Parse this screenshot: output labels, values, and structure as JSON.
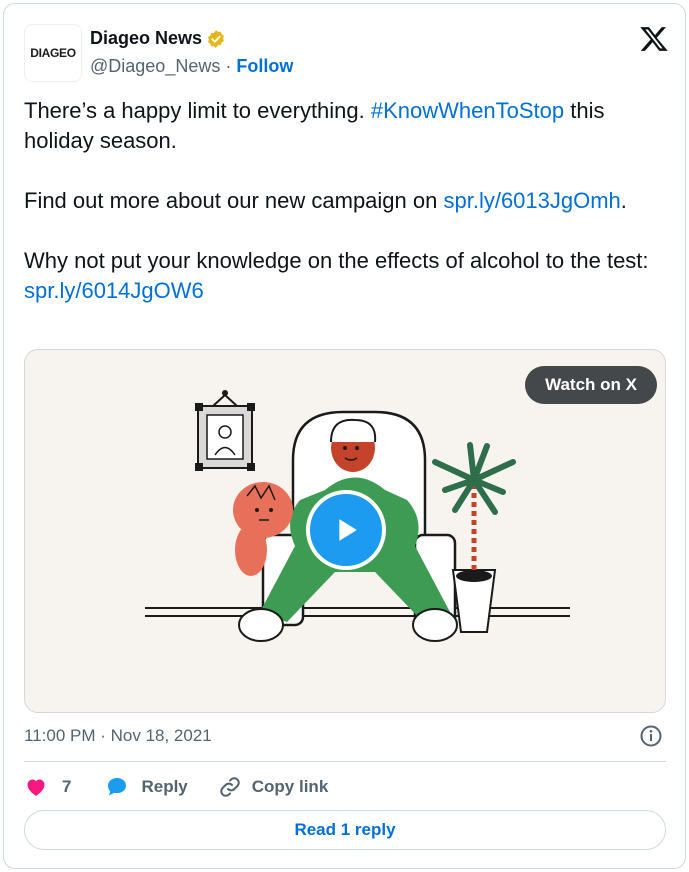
{
  "author": {
    "avatar_text": "DIAGEO",
    "display_name": "Diageo News",
    "handle": "@Diageo_News",
    "separator": "·",
    "follow_label": "Follow"
  },
  "tweet": {
    "line1_before": "There’s a happy limit to everything. ",
    "hashtag": "#KnowWhenToStop",
    "line1_after": " this holiday season.",
    "para2_text": "Find out more about our new campaign on ",
    "para2_link": "spr.ly/6013JgOmh",
    "para2_end": ".",
    "para3_text": "Why not put your knowledge on the effects of alcohol to the test: ",
    "para3_link": "spr.ly/6014JgOW6"
  },
  "media": {
    "watch_label": "Watch on X",
    "play_icon": "play-icon"
  },
  "timestamp": "11:00 PM · Nov 18, 2021",
  "actions": {
    "like_count": "7",
    "reply_label": "Reply",
    "copy_label": "Copy link"
  },
  "read_reply_label": "Read 1 reply",
  "colors": {
    "link": "#006fd6",
    "like": "#f91880",
    "play": "#1d9bf0",
    "badge": "#e2b719"
  }
}
